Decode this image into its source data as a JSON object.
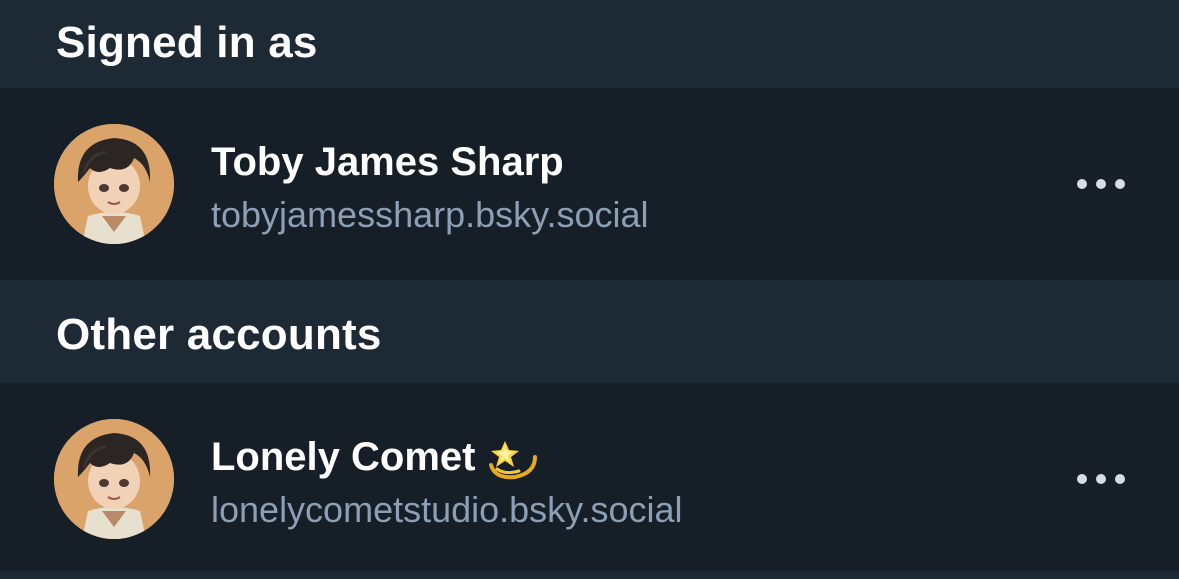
{
  "sections": {
    "signed_in": {
      "title": "Signed in as",
      "account": {
        "name": "Toby James Sharp",
        "handle": "tobyjamessharp.bsky.social"
      }
    },
    "other": {
      "title": "Other accounts",
      "account": {
        "name": "Lonely Comet",
        "name_emoji": "dizzy-star-emoji",
        "handle": "lonelycometstudio.bsky.social"
      }
    }
  },
  "colors": {
    "background": "#1e2936",
    "row_background": "#161e27",
    "handle_text": "#8d9fb5",
    "title_text": "#ffffff"
  },
  "icons": {
    "more": "more-horizontal-icon",
    "avatar": "avatar-illustration"
  }
}
